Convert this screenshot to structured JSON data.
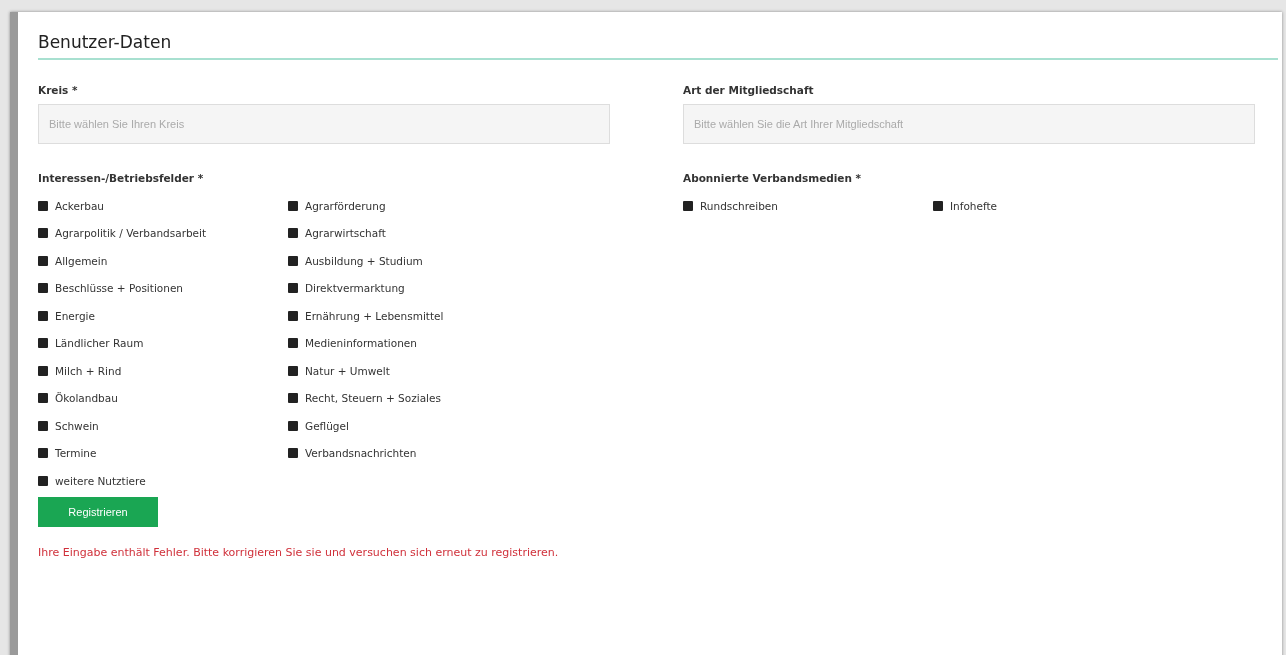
{
  "heading": "Benutzer-Daten",
  "left": {
    "field": {
      "label": "Kreis *",
      "placeholder": "Bitte wählen Sie Ihren Kreis"
    },
    "group": {
      "label": "Interessen-/Betriebsfelder *",
      "columns": [
        [
          "Ackerbau",
          "Agrarpolitik / Verbandsarbeit",
          "Allgemein",
          "Beschlüsse + Positionen",
          "Energie",
          "Ländlicher Raum",
          "Milch + Rind",
          "Ökolandbau",
          "Schwein",
          "Termine",
          "weitere Nutztiere"
        ],
        [
          "Agrarförderung",
          "Agrarwirtschaft",
          "Ausbildung + Studium",
          "Direktvermarktung",
          "Ernährung + Lebensmittel",
          "Medieninformationen",
          "Natur + Umwelt",
          "Recht, Steuern + Soziales",
          "Geflügel",
          "Verbandsnachrichten"
        ]
      ]
    }
  },
  "right": {
    "field": {
      "label": "Art der Mitgliedschaft",
      "placeholder": "Bitte wählen Sie die Art Ihrer Mitgliedschaft"
    },
    "group": {
      "label": "Abonnierte Verbandsmedien *",
      "columns": [
        [
          "Rundschreiben"
        ],
        [
          "Infohefte"
        ]
      ]
    }
  },
  "button": "Registrieren",
  "error": "Ihre Eingabe enthält Fehler. Bitte korrigieren Sie sie und versuchen sich erneut zu registrieren."
}
